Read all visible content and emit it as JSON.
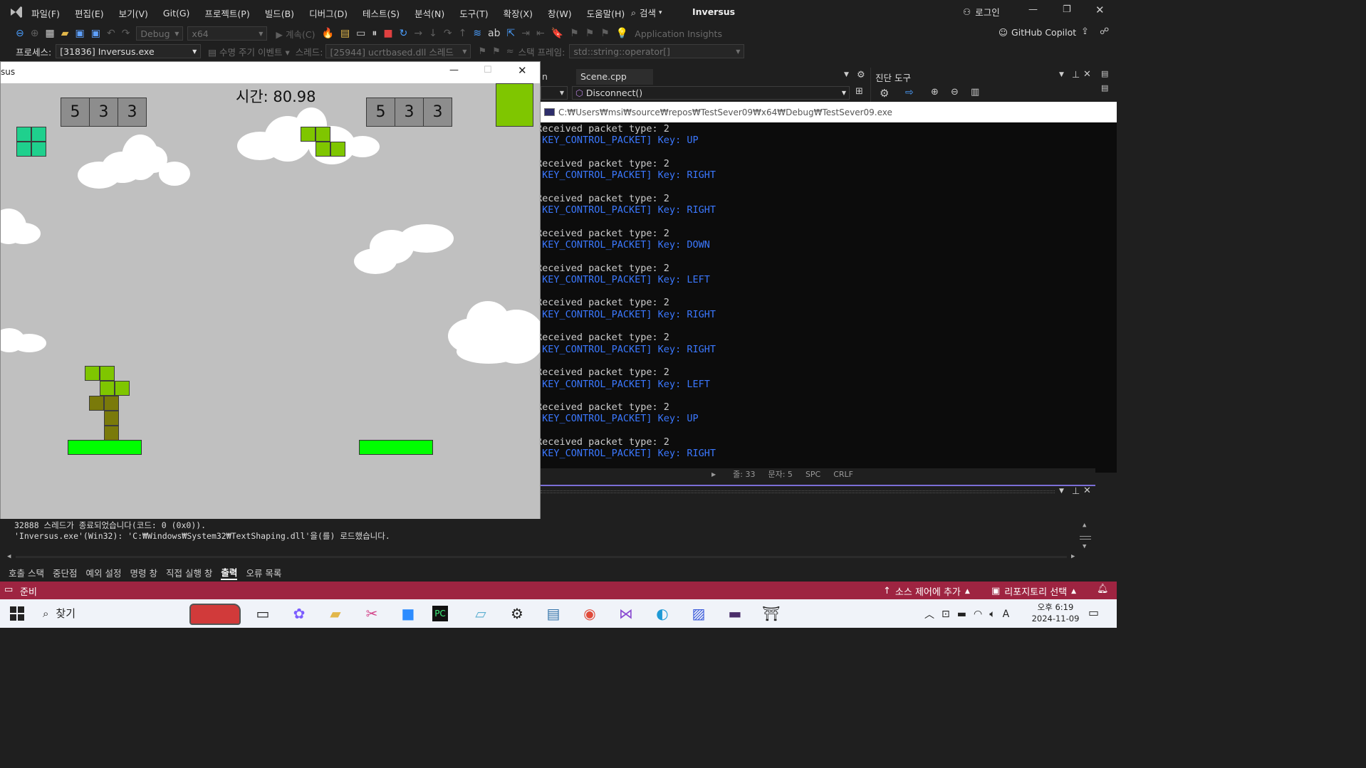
{
  "ide": {
    "app_title": "Inversus",
    "menu": [
      "파일(F)",
      "편집(E)",
      "보기(V)",
      "Git(G)",
      "프로젝트(P)",
      "빌드(B)",
      "디버그(D)",
      "테스트(S)",
      "분석(N)",
      "도구(T)",
      "확장(X)",
      "창(W)",
      "도움말(H)"
    ],
    "search_label": "검색",
    "login_label": "로그인",
    "toolbar": {
      "config": "Debug",
      "platform": "x64",
      "continue_label": "계속(C)",
      "insights": "Application Insights",
      "copilot": "GitHub Copilot"
    },
    "process_bar": {
      "process_label": "프로세스:",
      "process_value": "[31836] Inversus.exe",
      "lifecycle_label": "수명 주기 이벤트",
      "thread_label": "스레드:",
      "thread_value": "[25944] ucrtbased.dll 스레드",
      "stackframe_label": "스택 프레임:",
      "stackframe_value": "std::string::operator[]"
    },
    "editor": {
      "tab_partial": "n",
      "tab_scene": "Scene.cpp",
      "nav_function": "Disconnect()",
      "status_frag": [
        "줄: 33",
        "문자: 5",
        "SPC",
        "CRLF"
      ]
    },
    "diag_title": "진단 도구",
    "console": {
      "path": "C:₩Users₩msi₩source₩repos₩TestSever09₩x64₩Debug₩TestSever09.exe",
      "lines": [
        {
          "recv": "Received packet type: 2",
          "key": "[KEY_CONTROL_PACKET] Key: UP"
        },
        {
          "recv": "Received packet type: 2",
          "key": "[KEY_CONTROL_PACKET] Key: RIGHT"
        },
        {
          "recv": "Received packet type: 2",
          "key": "[KEY_CONTROL_PACKET] Key: RIGHT"
        },
        {
          "recv": "Received packet type: 2",
          "key": "[KEY_CONTROL_PACKET] Key: DOWN"
        },
        {
          "recv": "Received packet type: 2",
          "key": "[KEY_CONTROL_PACKET] Key: LEFT"
        },
        {
          "recv": "Received packet type: 2",
          "key": "[KEY_CONTROL_PACKET] Key: RIGHT"
        },
        {
          "recv": "Received packet type: 2",
          "key": "[KEY_CONTROL_PACKET] Key: RIGHT"
        },
        {
          "recv": "Received packet type: 2",
          "key": "[KEY_CONTROL_PACKET] Key: LEFT"
        },
        {
          "recv": "Received packet type: 2",
          "key": "[KEY_CONTROL_PACKET] Key: UP"
        },
        {
          "recv": "Received packet type: 2",
          "key": "[KEY_CONTROL_PACKET] Key: RIGHT"
        }
      ]
    },
    "output": {
      "line1": "32888 스레드가 종료되었습니다(코드: 0 (0x0)).",
      "line2": "'Inversus.exe'(Win32): 'C:₩Windows₩System32₩TextShaping.dll'을(를) 로드했습니다."
    },
    "bottom_tabs": [
      "호출 스택",
      "중단점",
      "예외 설정",
      "명령 창",
      "직접 실행 창",
      "출력",
      "오류 목록"
    ],
    "status": {
      "ready": "준비",
      "source_control": "소스 제어에 추가",
      "repo": "리포지토리 선택"
    }
  },
  "game": {
    "window_title_partial": "sus",
    "time_label": "시간: 80.98",
    "left_scores": [
      "5",
      "3",
      "3"
    ],
    "right_scores": [
      "5",
      "3",
      "3"
    ]
  },
  "taskbar": {
    "search_label": "찾기",
    "time": "오후 6:19",
    "date": "2024-11-09"
  },
  "colors": {
    "status_bar": "#9e2441",
    "console_blue": "#3b78ff",
    "game_bg": "#c0c0c0",
    "platform_green": "#00ff00"
  }
}
